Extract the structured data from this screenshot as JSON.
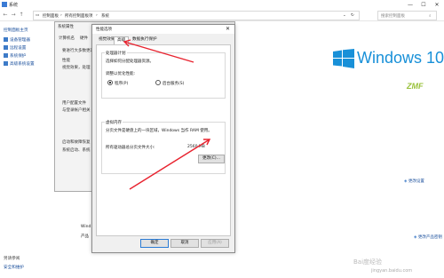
{
  "window": {
    "title": "系统",
    "controls": [
      "—",
      "☐",
      "✕"
    ]
  },
  "address": {
    "crumbs": [
      "控制面板",
      "›",
      "所有控制面板项",
      "›",
      "系统"
    ],
    "search_placeholder": "搜索控制面板"
  },
  "left_pane": {
    "home": "控制面板主页",
    "items": [
      "设备管理器",
      "远程设置",
      "系统保护",
      "高级系统设置"
    ],
    "see_also": "另请参阅",
    "security": "安全和维护"
  },
  "bg_dialog": {
    "title": "系统属性",
    "tabs": [
      "计算机名",
      "硬件"
    ],
    "lines": [
      "要进行大多数更改",
      "性能",
      "视觉效果，处理",
      "用户配置文件",
      "与登录帐户相关",
      "启动和故障恢复",
      "系统启动、系统"
    ]
  },
  "dialog": {
    "title": "性能选项",
    "tabs": [
      "视觉效果",
      "高级",
      "数据执行保护"
    ],
    "active_tab": 1,
    "processor": {
      "heading": "处理器计划",
      "desc": "选择如何分配处理器资源。",
      "label": "调整以优化性能:",
      "options": [
        "程序(P)",
        "后台服务(S)"
      ],
      "selected": 0
    },
    "vm": {
      "heading": "虚拟内存",
      "desc": "分页文件是硬盘上的一块区域，Windows 当作 RAM 使用。",
      "total_label": "所有驱动器总分页文件大小:",
      "total_value": "2560 MB",
      "change_button": "更改(C)..."
    },
    "buttons": [
      "确定",
      "取消",
      "应用(A)"
    ]
  },
  "right": {
    "logo_text": "Windows 10",
    "brand_text": "ZMF",
    "change_settings": "更改设置",
    "change_key": "更改产品密钥",
    "wind": "Wind",
    "product": "产品"
  },
  "watermark": {
    "line1": "Bai度经验",
    "line2": "jingyan.baidu.com"
  },
  "colors": {
    "accent": "#1890d8",
    "arrow": "#e8232f",
    "link": "#1a4f9c"
  }
}
